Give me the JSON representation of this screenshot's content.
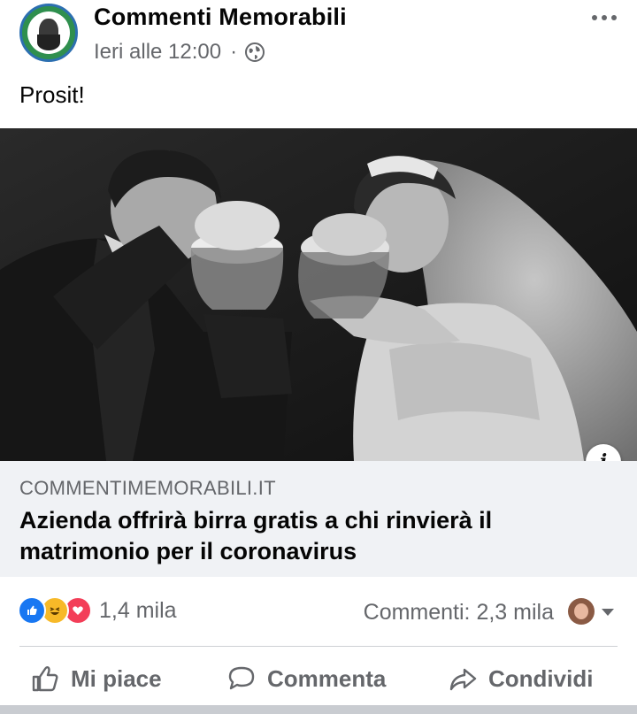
{
  "post": {
    "page_name": "Commenti Memorabili",
    "timestamp": "Ieri alle 12:00",
    "separator": "·",
    "privacy_icon": "globe-icon",
    "caption": "Prosit!"
  },
  "link_preview": {
    "domain": "COMMENTIMEMORABILI.IT",
    "title": "Azienda offrirà birra gratis a chi rinvierà il matrimonio per il coronavirus",
    "info_glyph": "i"
  },
  "stats": {
    "reactions": [
      "like",
      "haha",
      "love"
    ],
    "reaction_count": "1,4 mila",
    "comments": "Commenti: 2,3 mila"
  },
  "actions": {
    "like": "Mi piace",
    "comment": "Commenta",
    "share": "Condividi"
  },
  "colors": {
    "like_blue": "#1877f2",
    "haha_yellow": "#f7b928",
    "love_red": "#f33e58",
    "secondary_text": "#65676b",
    "link_box_bg": "#f0f2f5"
  }
}
